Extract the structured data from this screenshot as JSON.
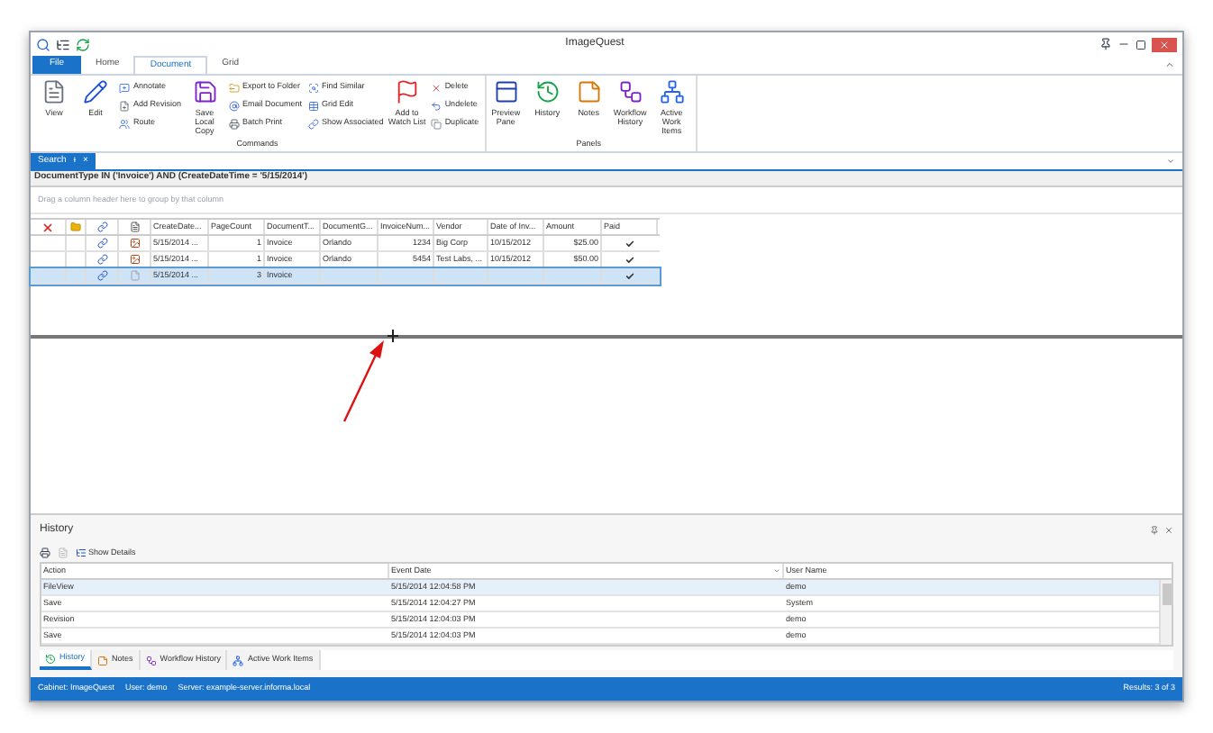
{
  "window": {
    "title": "ImageQuest"
  },
  "ribbon_tabs": [
    {
      "label": "File",
      "kind": "file",
      "selected": false
    },
    {
      "label": "Home",
      "kind": "tab",
      "selected": false
    },
    {
      "label": "Document",
      "kind": "tab",
      "selected": true
    },
    {
      "label": "Grid",
      "kind": "tab",
      "selected": false
    }
  ],
  "ribbon_groups": [
    {
      "label": "Commands",
      "columns": [
        {
          "kind": "large",
          "items": [
            "View"
          ]
        },
        {
          "kind": "large",
          "items": [
            "Edit"
          ]
        },
        {
          "kind": "stack",
          "items": [
            "Annotate",
            "Add Revision",
            "Route"
          ]
        },
        {
          "kind": "large",
          "items": [
            "Save Local Copy"
          ]
        },
        {
          "kind": "stack",
          "items": [
            "Export to Folder",
            "Email Document",
            "Batch Print"
          ]
        },
        {
          "kind": "stack",
          "items": [
            "Find Similar",
            "Grid Edit",
            "Show Associated"
          ]
        },
        {
          "kind": "large",
          "items": [
            "Add to Watch List"
          ]
        },
        {
          "kind": "stack",
          "items": [
            "Delete",
            "Undelete",
            "Duplicate"
          ]
        }
      ]
    },
    {
      "label": "Panels",
      "columns": [
        {
          "kind": "large",
          "items": [
            "Preview Pane"
          ]
        },
        {
          "kind": "large",
          "items": [
            "History"
          ]
        },
        {
          "kind": "large",
          "items": [
            "Notes"
          ]
        },
        {
          "kind": "large",
          "items": [
            "Workflow History"
          ]
        },
        {
          "kind": "large",
          "items": [
            "Active Work Items"
          ]
        }
      ]
    }
  ],
  "search_tab": {
    "label": "Search",
    "pin": "ᵻ",
    "close": "×"
  },
  "query": "DocumentType IN ('Invoice') AND (CreateDateTime = '5/15/2014')",
  "group_hint": "Drag a column header here to group by that column",
  "results": {
    "columns": [
      "CreateDate...",
      "PageCount",
      "DocumentT...",
      "DocumentG...",
      "InvoiceNum...",
      "Vendor",
      "Date of Inv...",
      "Amount",
      "Paid"
    ],
    "rows": [
      {
        "kind": "image",
        "selected": false,
        "paid": true,
        "cells": [
          "5/15/2014 ...",
          "1",
          "Invoice",
          "Orlando",
          "1234",
          "Big Corp",
          "10/15/2012",
          "$25.00"
        ]
      },
      {
        "kind": "image",
        "selected": false,
        "paid": true,
        "cells": [
          "5/15/2014 ...",
          "1",
          "Invoice",
          "Orlando",
          "5454",
          "Test Labs, ...",
          "10/15/2012",
          "$50.00"
        ]
      },
      {
        "kind": "blank",
        "selected": true,
        "paid": true,
        "cells": [
          "5/15/2014 ...",
          "3",
          "Invoice"
        ]
      }
    ]
  },
  "history": {
    "title": "History",
    "show_details": "Show Details",
    "columns": [
      "Action",
      "Event Date",
      "User Name"
    ],
    "rows": [
      {
        "selected": true,
        "cells": [
          "FileView",
          "5/15/2014 12:04:58 PM",
          "demo"
        ]
      },
      {
        "selected": false,
        "cells": [
          "Save",
          "5/15/2014 12:04:27 PM",
          "System"
        ]
      },
      {
        "selected": false,
        "cells": [
          "Revision",
          "5/15/2014 12:04:03 PM",
          "demo"
        ]
      },
      {
        "selected": false,
        "cells": [
          "Save",
          "5/15/2014 12:04:03 PM",
          "demo"
        ]
      }
    ],
    "tabs": [
      {
        "label": "History",
        "selected": true
      },
      {
        "label": "Notes",
        "selected": false
      },
      {
        "label": "Workflow History",
        "selected": false
      },
      {
        "label": "Active Work Items",
        "selected": false
      }
    ]
  },
  "status_bar": {
    "cabinet": "Cabinet: ImageQuest",
    "user": "User: demo",
    "server": "Server: example-server.informa.local",
    "results": "Results: 3 of 3"
  }
}
